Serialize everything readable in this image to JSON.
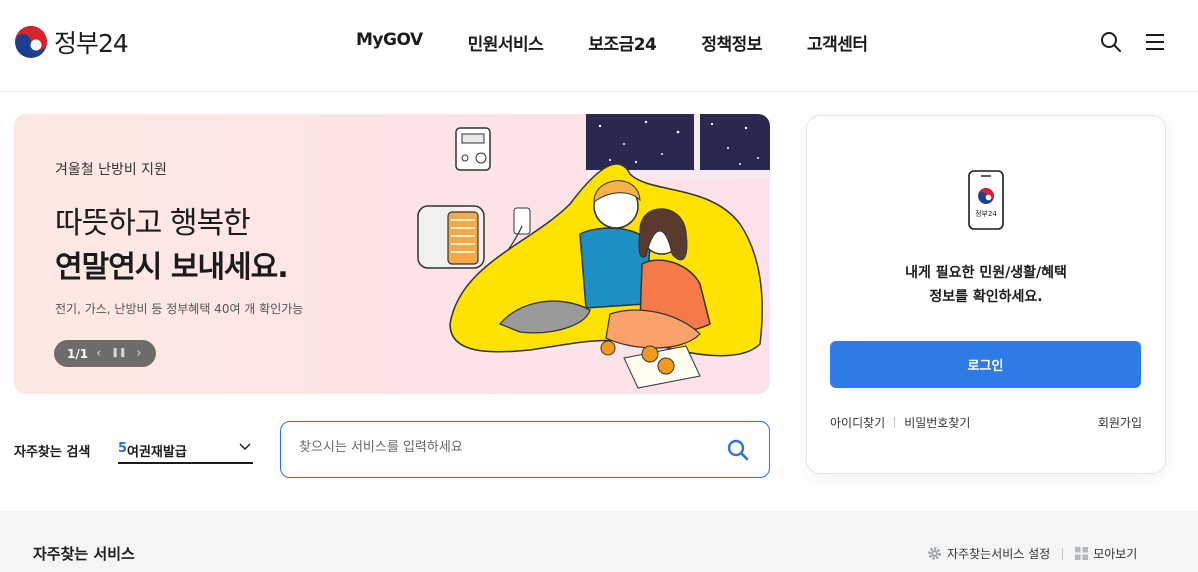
{
  "header": {
    "logo_text": "정부24",
    "nav": [
      {
        "label": "MyGOV"
      },
      {
        "label": "민원서비스"
      },
      {
        "label": "보조금24"
      },
      {
        "label": "정책정보"
      },
      {
        "label": "고객센터"
      }
    ],
    "icons": [
      "search-icon",
      "hamburger-menu-icon"
    ]
  },
  "banner": {
    "subtitle": "겨울철 난방비 지원",
    "title_line1": "따뜻하고 행복한",
    "title_line2": "연말연시 보내세요.",
    "description": "전기, 가스, 난방비 등 정부혜택 40여 개 확인가능",
    "page_indicator": "1/1",
    "controls": [
      "prev-icon",
      "pause-icon",
      "next-icon"
    ]
  },
  "frequent_search": {
    "label": "자주찾는 검색",
    "rank": "5",
    "keyword": "여권재발급"
  },
  "search": {
    "placeholder": "찾으시는 서비스를 입력하세요"
  },
  "login_card": {
    "phone_label": "정부24",
    "message_line1": "내게 필요한 민원/생활/혜택",
    "message_line2": "정보를 확인하세요.",
    "login_button": "로그인",
    "find_id": "아이디찾기",
    "find_password": "비밀번호찾기",
    "signup": "회원가입",
    "accent_color": "#2e7be6"
  },
  "services": {
    "title": "자주찾는 서비스",
    "settings_label": "자주찾는서비스 설정",
    "view_all_label": "모아보기"
  }
}
